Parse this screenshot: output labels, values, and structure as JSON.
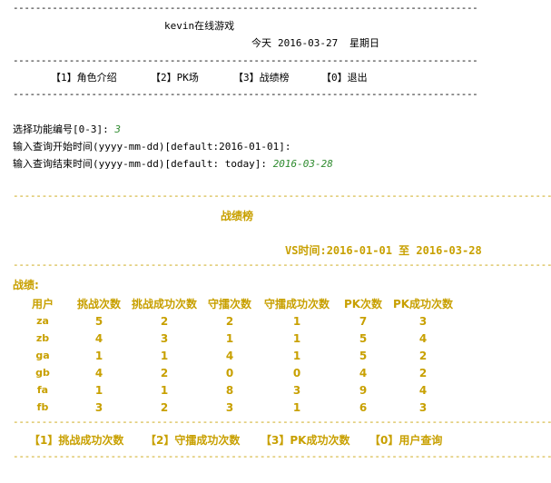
{
  "separator_black": "-----------------------------------------------------------------------------------",
  "separator_gold": "-------------------------------------------------------------------------------------------------",
  "header": {
    "game_title": "kevin在线游戏",
    "today_label": "今天",
    "date": "2016-03-27",
    "weekday": "星期日"
  },
  "main_menu": [
    {
      "label": "【1】角色介绍"
    },
    {
      "label": "【2】PK场"
    },
    {
      "label": "【3】战绩榜"
    },
    {
      "label": "【0】退出"
    }
  ],
  "console": {
    "prompt_select": "选择功能编号[0-3]:",
    "input_select": "3",
    "prompt_start": "输入查询开始时间(yyyy-mm-dd)[default:2016-01-01]:",
    "prompt_end": "输入查询结束时间(yyyy-mm-dd)[default: today]:",
    "input_end": "2016-03-28"
  },
  "leaderboard": {
    "title": "战绩榜",
    "vs_time_label": "VS时间:",
    "start": "2016-01-01",
    "to": "至",
    "end": "2016-03-28",
    "section_label": "战绩:",
    "columns": [
      "用户",
      "挑战次数",
      "挑战成功次数",
      "守擂次数",
      "守擂成功次数",
      "PK次数",
      "PK成功次数"
    ],
    "rows": [
      [
        "za",
        "5",
        "2",
        "2",
        "1",
        "7",
        "3"
      ],
      [
        "zb",
        "4",
        "3",
        "1",
        "1",
        "5",
        "4"
      ],
      [
        "ga",
        "1",
        "1",
        "4",
        "1",
        "5",
        "2"
      ],
      [
        "gb",
        "4",
        "2",
        "0",
        "0",
        "4",
        "2"
      ],
      [
        "fa",
        "1",
        "1",
        "8",
        "3",
        "9",
        "4"
      ],
      [
        "fb",
        "3",
        "2",
        "3",
        "1",
        "6",
        "3"
      ]
    ]
  },
  "sub_menu": [
    {
      "label": "【1】挑战成功次数"
    },
    {
      "label": "【2】守擂成功次数"
    },
    {
      "label": "【3】PK成功次数"
    },
    {
      "label": "【0】用户查询"
    }
  ]
}
